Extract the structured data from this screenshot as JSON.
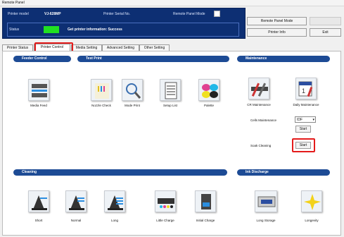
{
  "window_title": "Remote Panel",
  "topbar": {
    "printer_model_label": "Printer model",
    "printer_model_value": "VJ-628MP",
    "printer_serial_label": "Printer Serial No.",
    "remote_panel_mode_label": "Remote Panel Mode",
    "status_label": "Status",
    "status_message": "Get printer information: Success",
    "remote_panel_mode_button": "Remote Panel Mode",
    "printer_info_button": "Printer Info",
    "exit_button": "Exit"
  },
  "tabs": [
    {
      "label": "Printer Status"
    },
    {
      "label": "Printer Control"
    },
    {
      "label": "Media Setting"
    },
    {
      "label": "Advanced Setting"
    },
    {
      "label": "Other Setting"
    }
  ],
  "sections": {
    "feeder_control": {
      "title": "Feeder Control",
      "items": [
        {
          "label": "Media Feed",
          "icon": "media-feed-icon"
        }
      ]
    },
    "test_print": {
      "title": "Test Print",
      "items": [
        {
          "label": "Nozzle Check",
          "icon": "nozzle-check-icon"
        },
        {
          "label": "Mode Print",
          "icon": "mode-print-icon"
        },
        {
          "label": "Setup List",
          "icon": "setup-list-icon"
        },
        {
          "label": "Palette",
          "icon": "palette-icon"
        }
      ]
    },
    "maintenance": {
      "title": "Maintenance",
      "items": [
        {
          "label": "CR Maintenance",
          "icon": "cr-maintenance-icon"
        },
        {
          "label": "Daily Maintenance",
          "icon": "daily-maintenance-icon"
        }
      ],
      "cells_maintenance_label": "Cells Maintenance",
      "cells_maintenance_value": "IDF",
      "start_label": "Start",
      "soak_cleaning_label": "Soak Cleaning",
      "soak_start_label": "Start"
    },
    "cleaning": {
      "title": "Cleaning",
      "items": [
        {
          "label": "Short",
          "icon": "short-cleaning-icon"
        },
        {
          "label": "Normal",
          "icon": "normal-cleaning-icon"
        },
        {
          "label": "Long",
          "icon": "long-cleaning-icon"
        },
        {
          "label": "Little Charge",
          "icon": "little-charge-icon"
        },
        {
          "label": "Initial Charge",
          "icon": "initial-charge-icon"
        }
      ]
    },
    "ink_discharge": {
      "title": "Ink Discharge",
      "items": [
        {
          "label": "Long Storage",
          "icon": "long-storage-icon"
        },
        {
          "label": "Longevity",
          "icon": "longevity-icon"
        }
      ]
    }
  },
  "colors": {
    "header_blue": "#1d4b95",
    "status_green": "#21e021",
    "highlight_red": "#e41b1b"
  }
}
